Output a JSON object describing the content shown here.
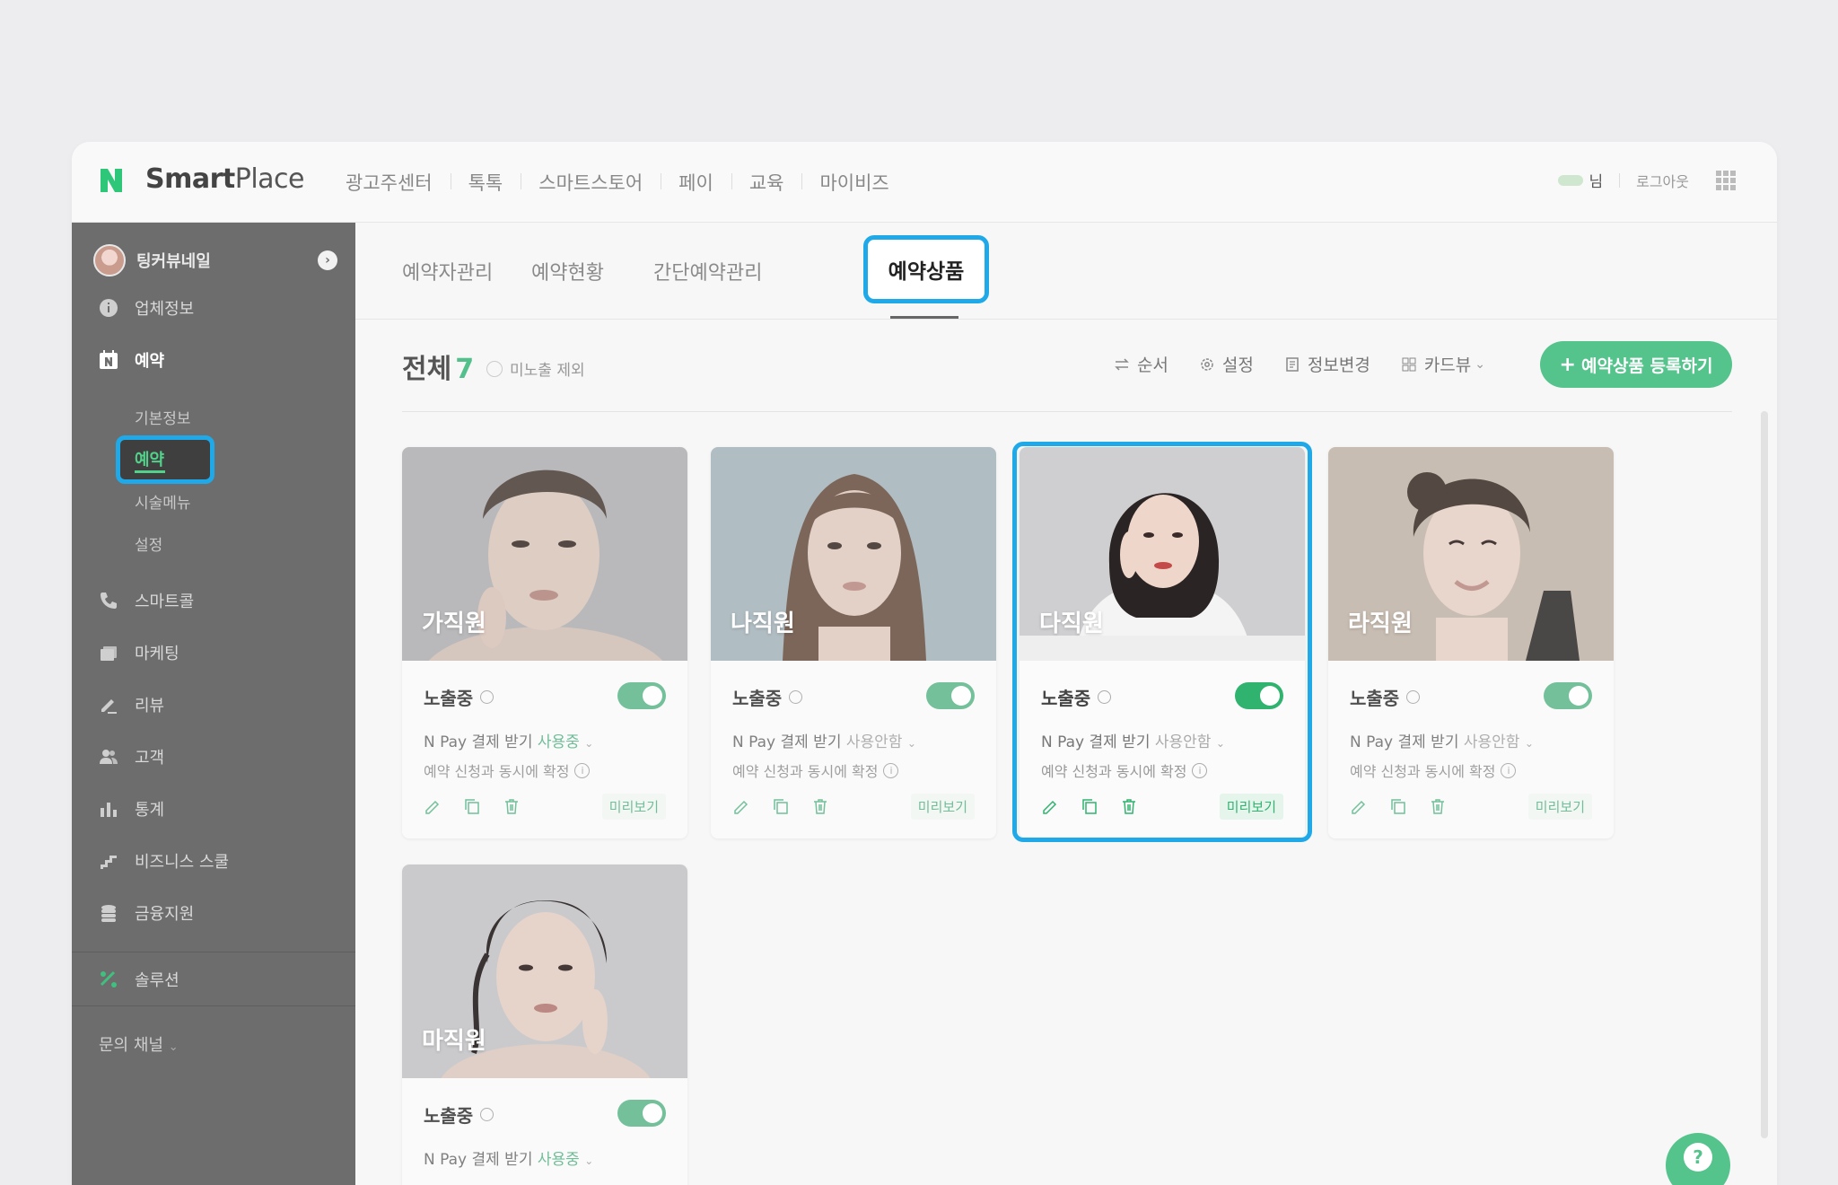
{
  "brand": {
    "logo_text_bold": "Smart",
    "logo_text_light": "Place"
  },
  "topnav": [
    "광고주센터",
    "톡톡",
    "스마트스토어",
    "페이",
    "교육",
    "마이비즈"
  ],
  "user": {
    "suffix": "님",
    "logout": "로그아웃"
  },
  "sidebar": {
    "profile_name": "팅커뷰네일",
    "items": [
      {
        "label": "업체정보"
      },
      {
        "label": "예약"
      },
      {
        "label": "스마트콜"
      },
      {
        "label": "마케팅"
      },
      {
        "label": "리뷰"
      },
      {
        "label": "고객"
      },
      {
        "label": "통계"
      },
      {
        "label": "비즈니스 스쿨"
      },
      {
        "label": "금융지원"
      },
      {
        "label": "솔루션"
      }
    ],
    "sub_items": [
      "기본정보",
      "예약",
      "시술메뉴",
      "설정"
    ],
    "channel": "문의 채널"
  },
  "tabs": [
    "예약자관리",
    "예약현황",
    "간단예약관리",
    "예약상품"
  ],
  "toolbar": {
    "total_label": "전체",
    "total_count": "7",
    "exclude_label": "미노출 제외",
    "order": "순서",
    "settings": "설정",
    "info_change": "정보변경",
    "card_view": "카드뷰",
    "register": "예약상품 등록하기"
  },
  "cards": [
    {
      "name": "가직원",
      "status": "노출중",
      "pay_label": "N Pay 결제 받기",
      "pay_value": "사용중",
      "confirm": "예약 신청과 동시에 확정",
      "preview": "미리보기"
    },
    {
      "name": "나직원",
      "status": "노출중",
      "pay_label": "N Pay 결제 받기",
      "pay_value": "사용안함",
      "confirm": "예약 신청과 동시에 확정",
      "preview": "미리보기"
    },
    {
      "name": "다직원",
      "status": "노출중",
      "pay_label": "N Pay 결제 받기",
      "pay_value": "사용안함",
      "confirm": "예약 신청과 동시에 확정",
      "preview": "미리보기"
    },
    {
      "name": "라직원",
      "status": "노출중",
      "pay_label": "N Pay 결제 받기",
      "pay_value": "사용안함",
      "confirm": "예약 신청과 동시에 확정",
      "preview": "미리보기"
    },
    {
      "name": "마직원",
      "status": "노출중",
      "pay_label": "N Pay 결제 받기",
      "pay_value": "사용중",
      "confirm": "",
      "preview": ""
    }
  ],
  "colors": {
    "accent": "#55c38c",
    "highlight": "#1fa9e8"
  }
}
